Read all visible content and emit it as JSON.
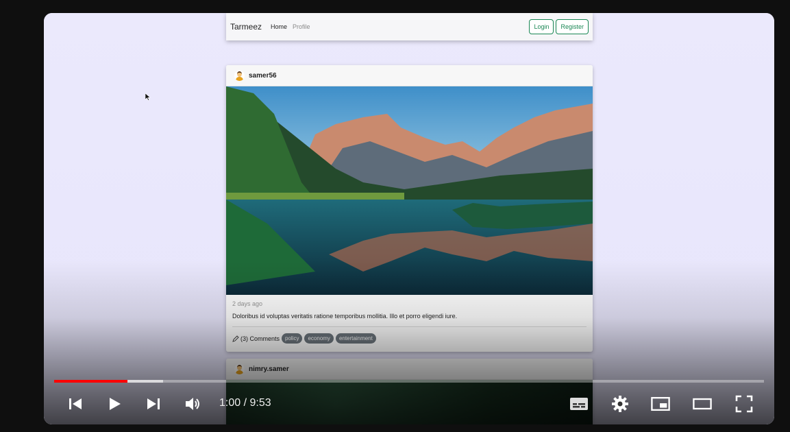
{
  "navbar": {
    "brand": "Tarmeez",
    "links": [
      "Home",
      "Profile"
    ],
    "login_label": "Login",
    "register_label": "Register"
  },
  "posts": [
    {
      "username": "samer56",
      "time": "2 days ago",
      "text": "Doloribus id voluptas veritatis ratione temporibus mollitia. Illo et porro eligendi iure.",
      "comments": "(3) Comments",
      "tags": [
        "policy",
        "economy",
        "entertainment"
      ]
    },
    {
      "username": "nimry.samer"
    }
  ],
  "player": {
    "time_display": "1:00 / 9:53",
    "played_fraction": 0.103,
    "buffered_fraction": 0.153,
    "accent_color": "#ff0000",
    "icons": [
      "previous-icon",
      "play-icon",
      "next-icon",
      "volume-icon",
      "subtitles-icon",
      "settings-icon",
      "miniplayer-icon",
      "theater-mode-icon",
      "fullscreen-icon"
    ]
  }
}
